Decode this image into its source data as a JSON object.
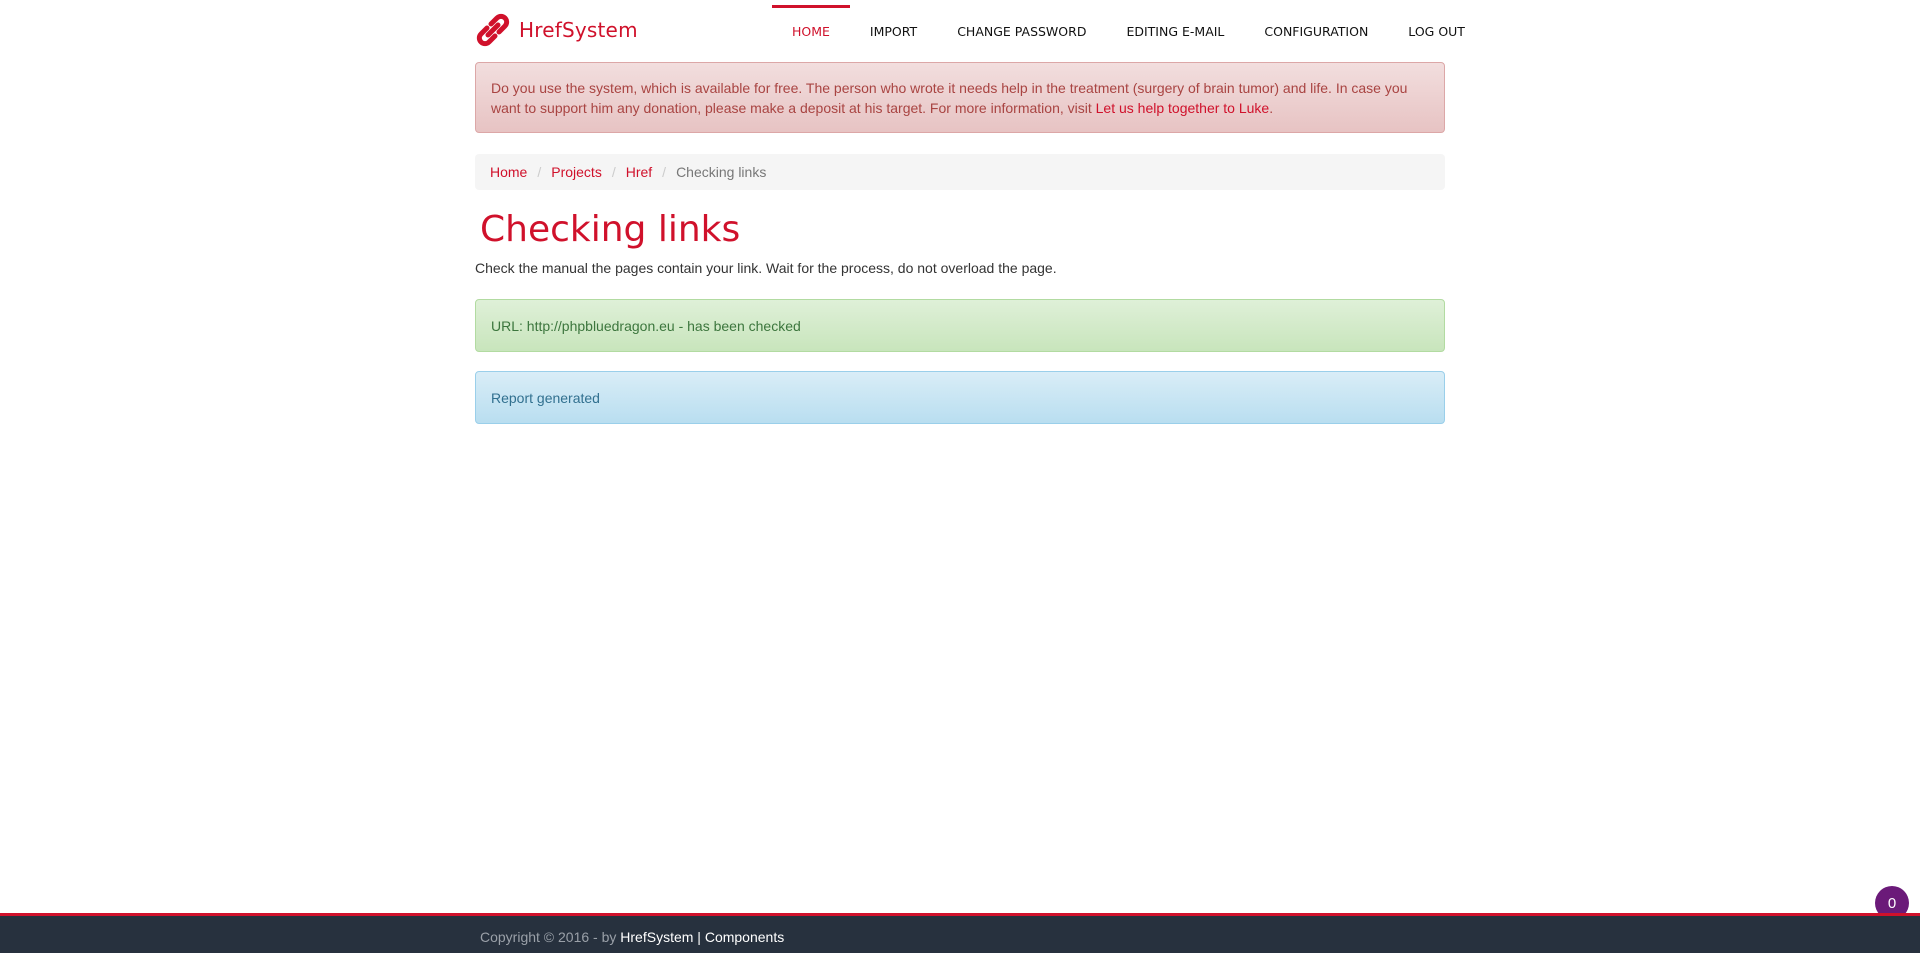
{
  "brand": {
    "name": "HrefSystem",
    "icon": "link-icon",
    "color": "#d0112b"
  },
  "nav": {
    "items": [
      {
        "label": "HOME",
        "active": true
      },
      {
        "label": "IMPORT",
        "active": false
      },
      {
        "label": "CHANGE PASSWORD",
        "active": false
      },
      {
        "label": "EDITING E-MAIL",
        "active": false
      },
      {
        "label": "CONFIGURATION",
        "active": false
      },
      {
        "label": "LOG OUT",
        "active": false
      }
    ]
  },
  "donation_alert": {
    "text": "Do you use the system, which is available for free. The person who wrote it needs help in the treatment (surgery of brain tumor) and life. In case you want to support him any donation, please make a deposit at his target. For more information, visit ",
    "link_text": "Let us help together to Luke",
    "end": "."
  },
  "breadcrumb": {
    "items": [
      "Home",
      "Projects",
      "Href"
    ],
    "current": "Checking links",
    "separator": "/"
  },
  "page": {
    "title": "Checking links",
    "lead": "Check the manual the pages contain your link. Wait for the process, do not overload the page."
  },
  "results": {
    "success": "URL: http://phpbluedragon.eu - has been checked",
    "info": "Report generated"
  },
  "footer": {
    "prefix": "Copyright © 2016 - by ",
    "brand_link": "HrefSystem",
    "pipe": " | ",
    "components_link": "Components"
  },
  "badge": {
    "count": "0",
    "color": "#6b1a79"
  },
  "colors": {
    "accent": "#d0112b",
    "footer_bg": "#27313e",
    "success_text": "#3c763d",
    "info_text": "#31708f",
    "danger_text": "#a94442"
  }
}
